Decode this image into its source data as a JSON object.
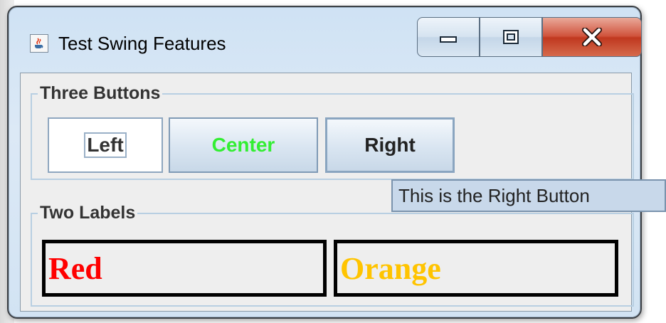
{
  "window": {
    "title": "Test Swing Features"
  },
  "groups": {
    "buttons_title": "Three Buttons",
    "labels_title": "Two Labels"
  },
  "buttons": {
    "left": "Left",
    "center": "Center",
    "right": "Right"
  },
  "tooltip": {
    "text": "This is the Right Button"
  },
  "labels": {
    "red": "Red",
    "orange": "Orange"
  },
  "colors": {
    "center_text": "#33ee33",
    "red_label": "#ff0000",
    "orange_label": "#ffc400"
  },
  "icons": {
    "app": "java-coffee-icon",
    "minimize": "minimize-icon",
    "maximize": "maximize-icon",
    "close": "close-icon"
  }
}
